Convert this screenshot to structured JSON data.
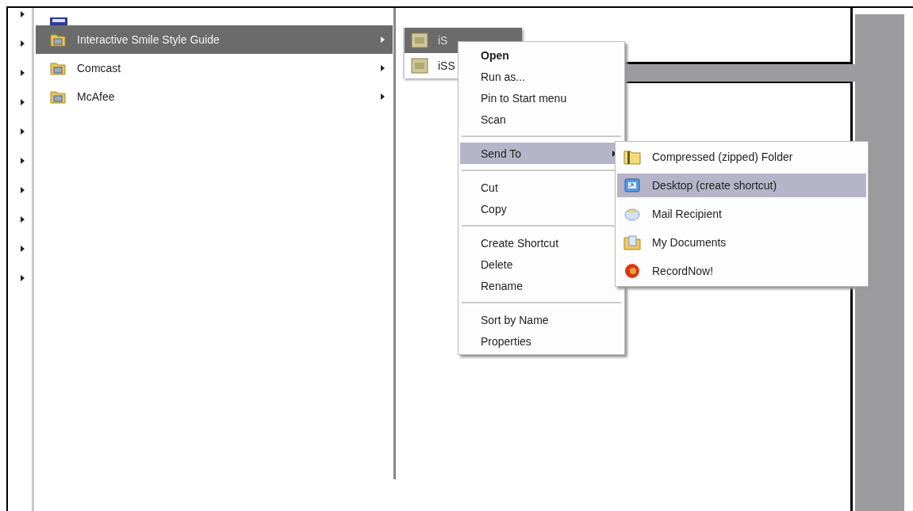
{
  "programs_menu": {
    "items": [
      {
        "label": "Interactive Smile Style Guide",
        "selected": true,
        "submenu": true
      },
      {
        "label": "Comcast",
        "selected": false,
        "submenu": true
      },
      {
        "label": "McAfee",
        "selected": false,
        "submenu": true
      }
    ]
  },
  "program_submenu": {
    "items": [
      {
        "label": "iS",
        "selected": true
      },
      {
        "label": "iSS",
        "selected": false
      }
    ]
  },
  "context_menu": {
    "groups": [
      [
        {
          "label": "Open",
          "bold": true,
          "selected": false,
          "submenu": false
        },
        {
          "label": "Run as...",
          "bold": false,
          "selected": false,
          "submenu": false
        },
        {
          "label": "Pin to Start menu",
          "bold": false,
          "selected": false,
          "submenu": false
        },
        {
          "label": "Scan",
          "bold": false,
          "selected": false,
          "submenu": false
        }
      ],
      [
        {
          "label": "Send To",
          "bold": false,
          "selected": true,
          "submenu": true
        }
      ],
      [
        {
          "label": "Cut",
          "bold": false,
          "selected": false,
          "submenu": false
        },
        {
          "label": "Copy",
          "bold": false,
          "selected": false,
          "submenu": false
        }
      ],
      [
        {
          "label": "Create Shortcut",
          "bold": false,
          "selected": false,
          "submenu": false
        },
        {
          "label": "Delete",
          "bold": false,
          "selected": false,
          "submenu": false
        },
        {
          "label": "Rename",
          "bold": false,
          "selected": false,
          "submenu": false
        }
      ],
      [
        {
          "label": "Sort by Name",
          "bold": false,
          "selected": false,
          "submenu": false
        },
        {
          "label": "Properties",
          "bold": false,
          "selected": false,
          "submenu": false
        }
      ]
    ]
  },
  "send_to_menu": {
    "items": [
      {
        "label": "Compressed (zipped) Folder",
        "selected": false
      },
      {
        "label": "Desktop (create shortcut)",
        "selected": true
      },
      {
        "label": "Mail Recipient",
        "selected": false
      },
      {
        "label": "My Documents",
        "selected": false
      },
      {
        "label": "RecordNow!",
        "selected": false
      }
    ]
  }
}
